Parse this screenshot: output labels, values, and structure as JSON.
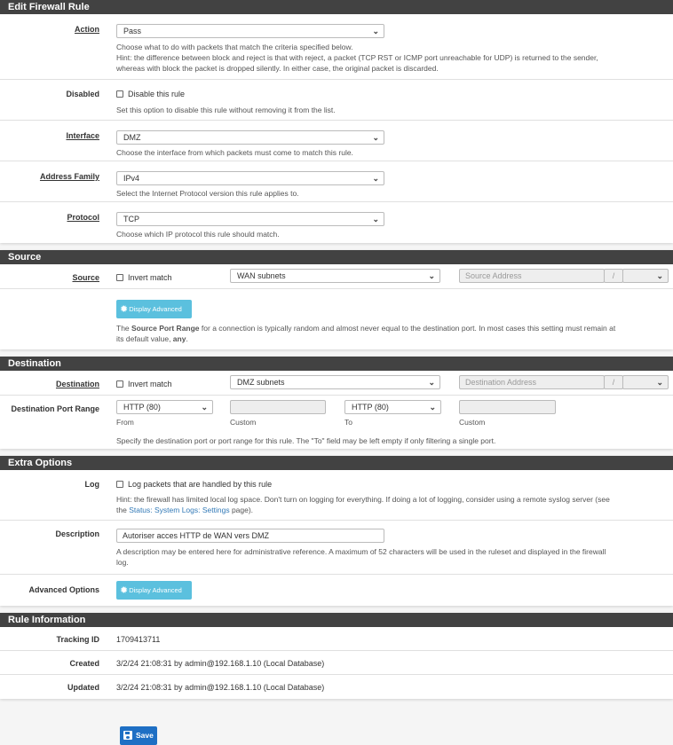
{
  "edit_rule": {
    "title": "Edit Firewall Rule",
    "action": {
      "label": "Action",
      "value": "Pass",
      "help1": "Choose what to do with packets that match the criteria specified below.",
      "help2": "Hint: the difference between block and reject is that with reject, a packet (TCP RST or ICMP port unreachable for UDP) is returned to the sender,",
      "help3": "whereas with block the packet is dropped silently. In either case, the original packet is discarded."
    },
    "disabled": {
      "label": "Disabled",
      "checkbox_label": "Disable this rule",
      "checked": false,
      "help": "Set this option to disable this rule without removing it from the list."
    },
    "interface": {
      "label": "Interface",
      "value": "DMZ",
      "help": "Choose the interface from which packets must come to match this rule."
    },
    "address_family": {
      "label": "Address Family",
      "value": "IPv4",
      "help": "Select the Internet Protocol version this rule applies to."
    },
    "protocol": {
      "label": "Protocol",
      "value": "TCP",
      "help": "Choose which IP protocol this rule should match."
    }
  },
  "source": {
    "title": "Source",
    "label": "Source",
    "invert_label": "Invert match",
    "invert_checked": false,
    "type": "WAN subnets",
    "address_placeholder": "Source Address",
    "slash": "/",
    "mask": "",
    "advanced_button": "Display Advanced",
    "help_pre": "The ",
    "help_bold": "Source Port Range",
    "help_mid": " for a connection is typically random and almost never equal to the destination port. In most cases this setting must remain at",
    "help_line2_pre": "its default value, ",
    "help_line2_bold": "any",
    "help_line2_post": "."
  },
  "destination": {
    "title": "Destination",
    "label": "Destination",
    "invert_label": "Invert match",
    "invert_checked": false,
    "type": "DMZ subnets",
    "address_placeholder": "Destination Address",
    "slash": "/",
    "mask": "",
    "port_range": {
      "label": "Destination Port Range",
      "from_value": "HTTP (80)",
      "from_caption": "From",
      "from_custom": "",
      "from_custom_caption": "Custom",
      "to_value": "HTTP (80)",
      "to_caption": "To",
      "to_custom": "",
      "to_custom_caption": "Custom",
      "help": "Specify the destination port or port range for this rule. The \"To\" field may be left empty if only filtering a single port."
    }
  },
  "extra": {
    "title": "Extra Options",
    "log": {
      "label": "Log",
      "checkbox_label": "Log packets that are handled by this rule",
      "checked": false,
      "help1": "Hint: the firewall has limited local log space. Don't turn on logging for everything. If doing a lot of logging, consider using a remote syslog server (see",
      "help2_pre": "the ",
      "help2_link": "Status: System Logs: Settings",
      "help2_post": " page)."
    },
    "description": {
      "label": "Description",
      "value": "Autoriser acces HTTP de WAN vers DMZ",
      "help1": "A description may be entered here for administrative reference. A maximum of 52 characters will be used in the ruleset and displayed in the firewall",
      "help2": "log."
    },
    "advanced": {
      "label": "Advanced Options",
      "button": "Display Advanced"
    }
  },
  "info": {
    "title": "Rule Information",
    "tracking_label": "Tracking ID",
    "tracking_value": "1709413711",
    "created_label": "Created",
    "created_value": "3/2/24 21:08:31 by admin@192.168.1.10 (Local Database)",
    "updated_label": "Updated",
    "updated_value": "3/2/24 21:08:31 by admin@192.168.1.10 (Local Database)"
  },
  "save_button": "Save",
  "icons": {
    "chevron": "❯",
    "gear": "✹"
  }
}
